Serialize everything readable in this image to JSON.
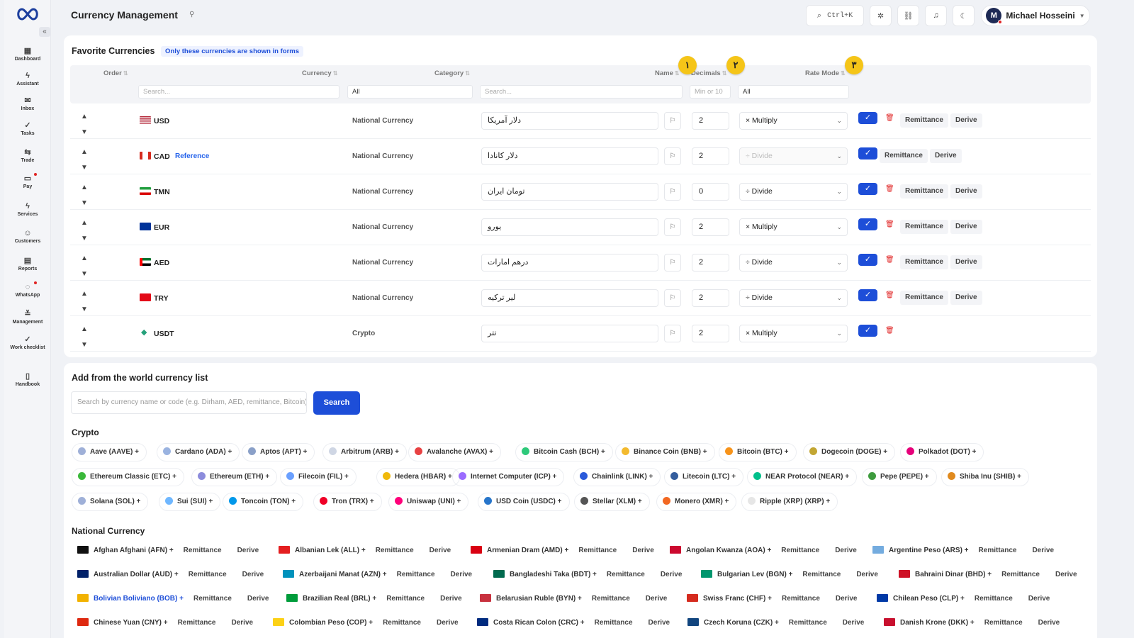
{
  "app": {
    "title": "Currency Management"
  },
  "topbar": {
    "shortcut": "Ctrl+K",
    "user_name": "Michael Hosseini",
    "user_initial": "M"
  },
  "nav": [
    {
      "label": "Dashboard",
      "icon": "dashboard-icon",
      "glyph": "▦"
    },
    {
      "label": "Assistant",
      "icon": "bolt-icon",
      "glyph": "ϟ"
    },
    {
      "label": "Inbox",
      "icon": "inbox-icon",
      "glyph": "✉"
    },
    {
      "label": "Tasks",
      "icon": "check-icon",
      "glyph": "✓"
    },
    {
      "label": "Trade",
      "icon": "swap-icon",
      "glyph": "⇆"
    },
    {
      "label": "Pay",
      "icon": "card-icon",
      "glyph": "▭"
    },
    {
      "label": "Services",
      "icon": "bolt-icon",
      "glyph": "ϟ"
    },
    {
      "label": "Customers",
      "icon": "users-icon",
      "glyph": "☺"
    },
    {
      "label": "Reports",
      "icon": "report-icon",
      "glyph": "▤"
    },
    {
      "label": "WhatsApp",
      "icon": "chat-icon",
      "glyph": "◌"
    },
    {
      "label": "Management",
      "icon": "sliders-icon",
      "glyph": "≚"
    },
    {
      "label": "Work checklist",
      "icon": "check-icon",
      "glyph": "✓"
    },
    {
      "label": "Handbook",
      "icon": "book-icon",
      "glyph": "▯"
    }
  ],
  "favorites": {
    "title": "Favorite Currencies",
    "info": "Only these currencies are shown in forms",
    "columns": {
      "order": "Order",
      "currency": "Currency",
      "category": "Category",
      "name": "Name",
      "decimals": "Decimals",
      "rate_mode": "Rate Mode"
    },
    "filters": {
      "currency": "Search...",
      "category": "All",
      "name": "Search...",
      "decimals": "Min or 10",
      "rate_mode": "All"
    },
    "badges": [
      "١",
      "٢",
      "٣"
    ],
    "rows": [
      {
        "code": "USD",
        "ref": "",
        "category": "National Currency",
        "name": "دلار آمریکا",
        "decimals": "2",
        "mode": "× Multiply",
        "flag": "us"
      },
      {
        "code": "CAD",
        "ref": "Reference",
        "category": "National Currency",
        "name": "دلار کانادا",
        "decimals": "2",
        "mode": "÷ Divide",
        "flag": "ca"
      },
      {
        "code": "TMN",
        "ref": "",
        "category": "National Currency",
        "name": "تومان ایران",
        "decimals": "0",
        "mode": "÷ Divide",
        "flag": "ir"
      },
      {
        "code": "EUR",
        "ref": "",
        "category": "National Currency",
        "name": "یورو",
        "decimals": "2",
        "mode": "× Multiply",
        "flag": "eu"
      },
      {
        "code": "AED",
        "ref": "",
        "category": "National Currency",
        "name": "درهم امارات",
        "decimals": "2",
        "mode": "÷ Divide",
        "flag": "ae"
      },
      {
        "code": "TRY",
        "ref": "",
        "category": "National Currency",
        "name": "لیر ترکیه",
        "decimals": "2",
        "mode": "÷ Divide",
        "flag": "tr"
      },
      {
        "code": "USDT",
        "ref": "",
        "category": "Crypto",
        "name": "تتر",
        "decimals": "2",
        "mode": "× Multiply",
        "flag": "usdt"
      }
    ],
    "chip_remittance": "Remittance",
    "chip_derive": "Derive"
  },
  "world": {
    "title": "Add from the world currency list",
    "search_placeholder": "Search by currency name or code (e.g. Dirham, AED, remittance, Bitcoin)",
    "search_button": "Search",
    "crypto_title": "Crypto",
    "national_title": "National Currency",
    "crypto": [
      [
        "Aave (AAVE) +",
        "Cardano (ADA) +",
        "Aptos (APT) +",
        "Arbitrum (ARB) +",
        "Avalanche (AVAX) +",
        "Bitcoin Cash (BCH) +",
        "Binance Coin (BNB) +",
        "Bitcoin (BTC) +",
        "Dogecoin (DOGE) +",
        "Polkadot (DOT) +"
      ],
      [
        "Ethereum Classic (ETC) +",
        "Ethereum (ETH) +",
        "Filecoin (FIL) +",
        "Hedera (HBAR) +",
        "Internet Computer (ICP) +",
        "Chainlink (LINK) +",
        "Litecoin (LTC) +",
        "NEAR Protocol (NEAR) +",
        "Pepe (PEPE) +",
        "Shiba Inu (SHIB) +"
      ],
      [
        "Solana (SOL) +",
        "Sui (SUI) +",
        "Toncoin (TON) +",
        "Tron (TRX) +",
        "Uniswap (UNI) +",
        "USD Coin (USDC) +",
        "Stellar (XLM) +",
        "Monero (XMR) +",
        "Ripple (XRP) (XRP) +"
      ]
    ],
    "crypto_colors": [
      [
        "#9fb0d8",
        "#9ab3e0",
        "#8aa0c8",
        "#cfd6e4",
        "#e84142",
        "#2ec97a",
        "#f3ba2f",
        "#f7931a",
        "#c2a633",
        "#e6007a"
      ],
      [
        "#3ab83a",
        "#8c8cdc",
        "#6aa0ff",
        "#f0b90b",
        "#9b6cff",
        "#2a5ada",
        "#345d9d",
        "#00c08b",
        "#3d9b3d",
        "#e08a1e"
      ],
      [
        "#9fb0d8",
        "#6fb7ff",
        "#0098ea",
        "#ef0027",
        "#ff007a",
        "#2775ca",
        "#555555",
        "#f26822",
        "#e6e6e6"
      ]
    ],
    "national": [
      [
        "Afghan Afghani (AFN) +",
        "Albanian Lek (ALL) +",
        "Armenian Dram (AMD) +",
        "Angolan Kwanza (AOA) +",
        "Argentine Peso (ARS) +"
      ],
      [
        "Australian Dollar (AUD) +",
        "Azerbaijani Manat (AZN) +",
        "Bangladeshi Taka (BDT) +",
        "Bulgarian Lev (BGN) +",
        "Bahraini Dinar (BHD) +"
      ],
      [
        "Bolivian Boliviano (BOB) +",
        "Brazilian Real (BRL) +",
        "Belarusian Ruble (BYN) +",
        "Swiss Franc (CHF) +",
        "Chilean Peso (CLP) +"
      ],
      [
        "Chinese Yuan (CNY) +",
        "Colombian Peso (COP) +",
        "Costa Rican Colon (CRC) +",
        "Czech Koruna (CZK) +",
        "Danish Krone (DKK) +"
      ]
    ],
    "national_flags": [
      [
        "#111111",
        "#e41e20",
        "#d90012",
        "#cc092f",
        "#74acdf"
      ],
      [
        "#012169",
        "#0092bc",
        "#006a4e",
        "#00966e",
        "#ce1126"
      ],
      [
        "#f2b200",
        "#009c3b",
        "#c8313e",
        "#d52b1e",
        "#0039a6"
      ],
      [
        "#de2910",
        "#fcd116",
        "#002b7f",
        "#11457e",
        "#c8102e"
      ]
    ],
    "highlight": "Bolivian Boliviano (BOB) +"
  }
}
